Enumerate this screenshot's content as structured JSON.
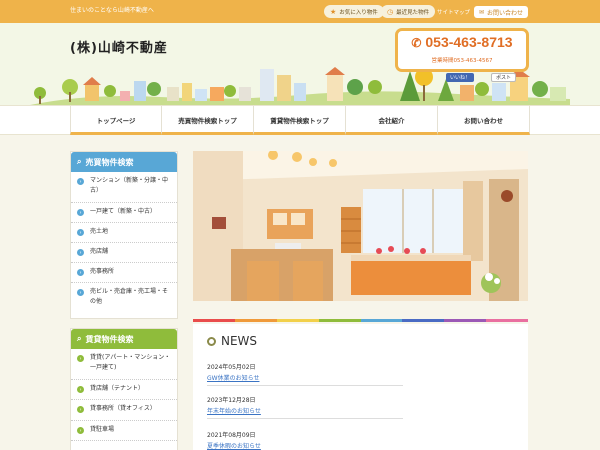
{
  "topbar": {
    "tagline": "住まいのことなら山崎不動産へ",
    "favorites_label": "お気に入り物件",
    "recent_label": "最近見た物件",
    "sitemap_label": "サイトマップ",
    "contact_label": "お問い合わせ"
  },
  "header": {
    "company_name": "(株)山崎不動産",
    "phone": "053-463-8713",
    "hours": "営業時間053-463-4567",
    "fb_like": "いいね！",
    "tw_post": "ポスト"
  },
  "nav": {
    "items": [
      {
        "label": "トップページ"
      },
      {
        "label": "売買物件検索トップ"
      },
      {
        "label": "賃貸物件検索トップ"
      },
      {
        "label": "会社紹介"
      },
      {
        "label": "お問い合わせ"
      }
    ]
  },
  "sidebar": {
    "sale_title": "売買物件検索",
    "sale_items": [
      {
        "label": "マンション（新築・分譲・中古）"
      },
      {
        "label": "一戸建て（新築・中古）"
      },
      {
        "label": "売土地"
      },
      {
        "label": "売店舗"
      },
      {
        "label": "売事務所"
      },
      {
        "label": "売ビル・売倉庫・売工場・その他"
      }
    ],
    "rent_title": "賃貸物件検索",
    "rent_items": [
      {
        "label": "貸貸(アパート・マンション・一戸建て)"
      },
      {
        "label": "貸店舗（テナント）"
      },
      {
        "label": "貸事務所（貸オフィス）"
      },
      {
        "label": "貸駐車場"
      }
    ]
  },
  "news": {
    "title": "NEWS",
    "entries": [
      {
        "date": "2024年05月02日",
        "title": "GW休業のお知らせ"
      },
      {
        "date": "2023年12月28日",
        "title": "年末年始のお知らせ"
      },
      {
        "date": "2021年08月09日",
        "title": "夏季休暇のお知らせ"
      }
    ]
  },
  "colors": {
    "topbar": "#efb34a",
    "phone": "#e06e25",
    "sale_heading": "#58a7d6",
    "rent_heading": "#8fbc3b",
    "link": "#3b74c4"
  },
  "icons": {
    "favorites": "star-icon",
    "recent": "clock-icon",
    "contact": "mail-icon",
    "phone": "phone-icon",
    "search": "search-icon"
  }
}
